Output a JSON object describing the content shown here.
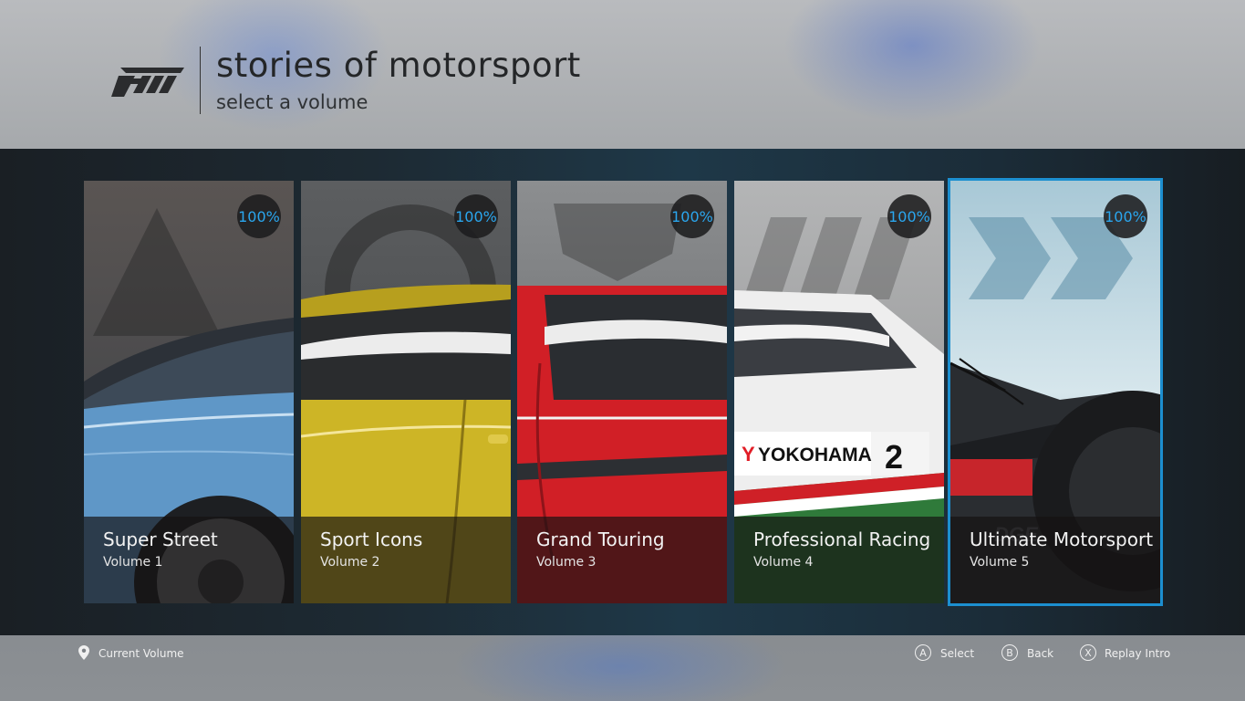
{
  "header": {
    "title": "stories of motorsport",
    "subtitle": "select a volume"
  },
  "volumes": [
    {
      "name": "Super Street",
      "volume": "Volume 1",
      "progress": "100%",
      "emblem": "triangle-emblem",
      "car_color": "#5f97c7"
    },
    {
      "name": "Sport Icons",
      "volume": "Volume 2",
      "progress": "100%",
      "emblem": "target-emblem",
      "car_color": "#cdb526"
    },
    {
      "name": "Grand Touring",
      "volume": "Volume 3",
      "progress": "100%",
      "emblem": "shield-emblem",
      "car_color": "#d11f26"
    },
    {
      "name": "Professional Racing",
      "volume": "Volume 4",
      "progress": "100%",
      "emblem": "stripes-emblem",
      "car_color": "#eeeeee",
      "livery_text": "YOKOHAMA",
      "race_number": "2"
    },
    {
      "name": "Ultimate Motorsport",
      "volume": "Volume 5",
      "progress": "100%",
      "emblem": "chevrons-emblem",
      "car_color": "#2a2d31",
      "selected": true
    }
  ],
  "footer": {
    "current_volume": "Current Volume",
    "actions": [
      {
        "key": "A",
        "label": "Select"
      },
      {
        "key": "B",
        "label": "Back"
      },
      {
        "key": "X",
        "label": "Replay Intro"
      }
    ]
  },
  "colors": {
    "accent": "#1c8fd0",
    "progress_text": "#2aa6ee"
  }
}
